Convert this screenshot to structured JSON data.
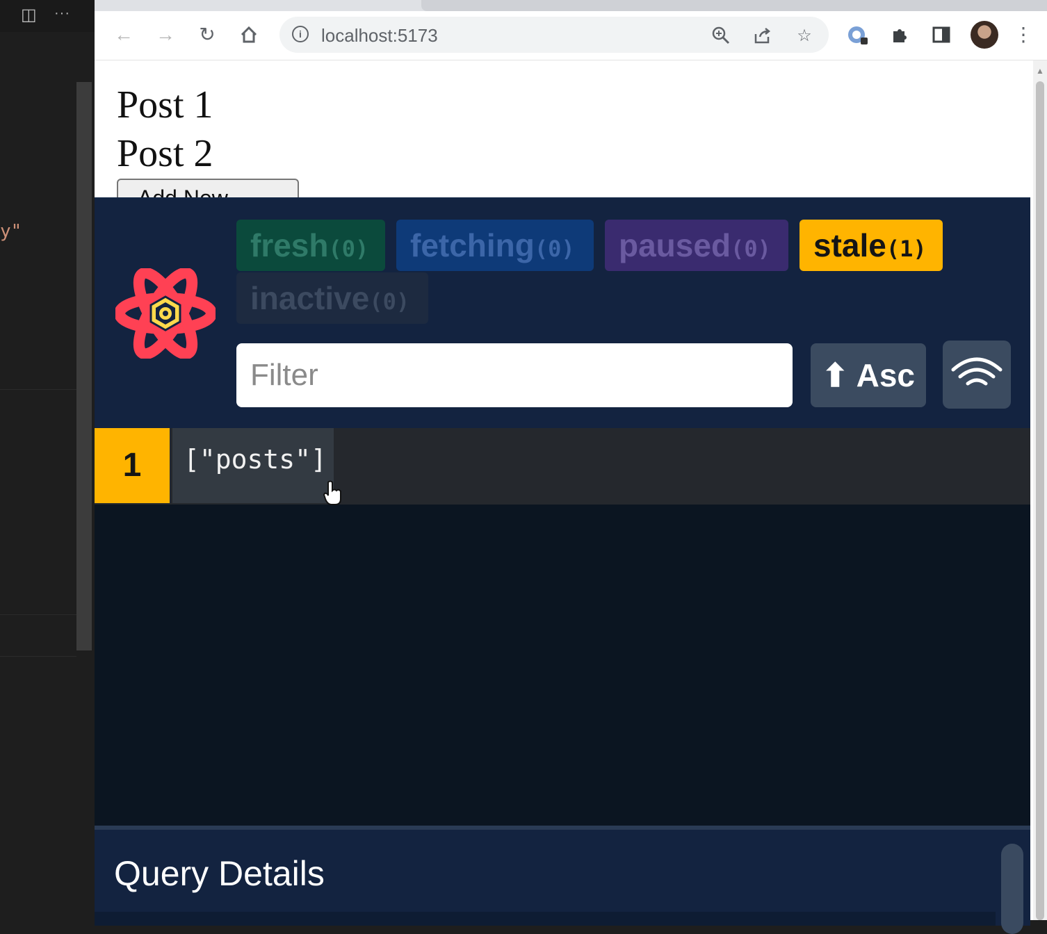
{
  "editor": {
    "code_fragment": "y\""
  },
  "browser": {
    "url": "localhost:5173",
    "icons": {
      "back": "arrow-left-icon",
      "forward": "arrow-right-icon",
      "reload": "reload-icon",
      "home": "home-icon",
      "site_info": "info-icon",
      "zoom": "zoom-icon",
      "share": "share-icon",
      "bookmark": "star-icon",
      "extension_react_query": "extension-icon",
      "extensions": "puzzle-icon",
      "side_panel": "side-panel-icon",
      "profile": "avatar",
      "menu": "kebab-menu-icon"
    }
  },
  "page": {
    "posts": [
      "Post 1",
      "Post 2"
    ],
    "add_button_label": "Add New"
  },
  "devtools": {
    "badges": {
      "fresh": {
        "label": "fresh",
        "count": "(0)"
      },
      "fetching": {
        "label": "fetching",
        "count": "(0)"
      },
      "paused": {
        "label": "paused",
        "count": "(0)"
      },
      "stale": {
        "label": "stale",
        "count": "(1)"
      },
      "inactive": {
        "label": "inactive",
        "count": "(0)"
      }
    },
    "filter_placeholder": "Filter",
    "sort_label": "⬆ Asc",
    "queries": [
      {
        "observers": "1",
        "key": "[\"posts\"]"
      }
    ],
    "details_title": "Query Details",
    "colors": {
      "panel_bg": "#0b1521",
      "header_bg": "#132340",
      "stale": "#ffb400",
      "fresh": "#0b4a3c",
      "fetching": "#0e3a78",
      "paused": "#3a2b6f",
      "inactive": "#1d2a40",
      "logo": "#ff4154"
    }
  }
}
